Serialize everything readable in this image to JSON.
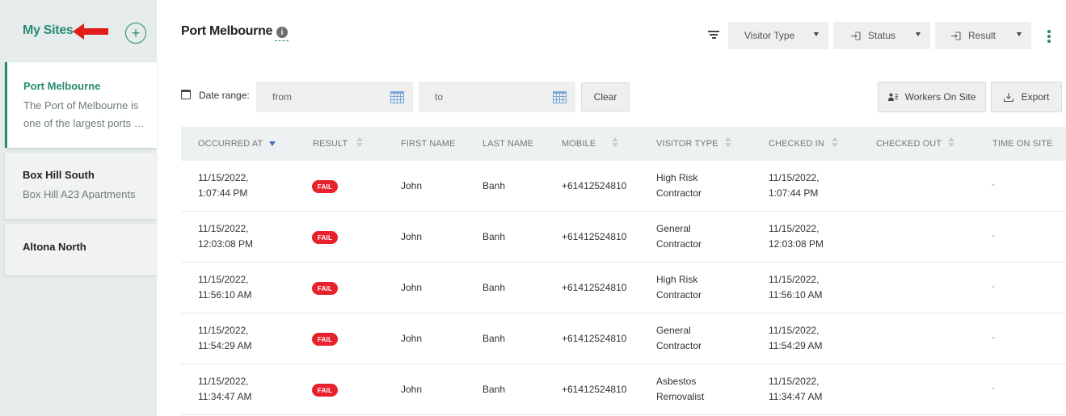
{
  "sidebar": {
    "title": "My Sites",
    "add_label": "+",
    "sites": [
      {
        "name": "Port Melbourne",
        "description_line1": "The Port of Melbourne is",
        "description_line2": "one of the largest ports …"
      },
      {
        "name": "Box Hill South",
        "description_line1": "Box Hill A23 Apartments"
      },
      {
        "name": "Altona North"
      }
    ]
  },
  "header": {
    "title": "Port Melbourne",
    "info_glyph": "i",
    "filters": {
      "visitor_type": "Visitor Type",
      "status": "Status",
      "result": "Result"
    }
  },
  "toolbar": {
    "date_range_label": "Date range:",
    "from_placeholder": "from",
    "to_placeholder": "to",
    "clear_label": "Clear",
    "workers_label": "Workers On Site",
    "export_label": "Export"
  },
  "table": {
    "columns": [
      "Occurred At",
      "Result",
      "First Name",
      "Last Name",
      "Mobile",
      "Visitor Type",
      "Checked In",
      "Checked Out",
      "Time On Site"
    ],
    "rows": [
      {
        "occurred_date": "11/15/2022,",
        "occurred_time": "1:07:44 PM",
        "result": "FAIL",
        "first": "John",
        "last": "Banh",
        "mobile": "+61412524810",
        "type1": "High Risk",
        "type2": "Contractor",
        "in_date": "11/15/2022,",
        "in_time": "1:07:44 PM",
        "out": "",
        "time_on_site": "-"
      },
      {
        "occurred_date": "11/15/2022,",
        "occurred_time": "12:03:08 PM",
        "result": "FAIL",
        "first": "John",
        "last": "Banh",
        "mobile": "+61412524810",
        "type1": "General",
        "type2": "Contractor",
        "in_date": "11/15/2022,",
        "in_time": "12:03:08 PM",
        "out": "",
        "time_on_site": "-"
      },
      {
        "occurred_date": "11/15/2022,",
        "occurred_time": "11:56:10 AM",
        "result": "FAIL",
        "first": "John",
        "last": "Banh",
        "mobile": "+61412524810",
        "type1": "High Risk",
        "type2": "Contractor",
        "in_date": "11/15/2022,",
        "in_time": "11:56:10 AM",
        "out": "",
        "time_on_site": "-"
      },
      {
        "occurred_date": "11/15/2022,",
        "occurred_time": "11:54:29 AM",
        "result": "FAIL",
        "first": "John",
        "last": "Banh",
        "mobile": "+61412524810",
        "type1": "General",
        "type2": "Contractor",
        "in_date": "11/15/2022,",
        "in_time": "11:54:29 AM",
        "out": "",
        "time_on_site": "-"
      },
      {
        "occurred_date": "11/15/2022,",
        "occurred_time": "11:34:47 AM",
        "result": "FAIL",
        "first": "John",
        "last": "Banh",
        "mobile": "+61412524810",
        "type1": "Asbestos",
        "type2": "Removalist",
        "in_date": "11/15/2022,",
        "in_time": "11:34:47 AM",
        "out": "",
        "time_on_site": "-"
      }
    ]
  },
  "colors": {
    "accent": "#2b8a72",
    "fail": "#e8222c",
    "sidebar_bg": "#e5eceb",
    "sort_active": "#4b6cc4"
  },
  "icons": {
    "filter": "filter-icon",
    "calendar": "calendar-icon",
    "kebab": "kebab-menu-icon",
    "add": "add-circle-icon",
    "export": "export-icon",
    "workers": "person-list-icon"
  }
}
